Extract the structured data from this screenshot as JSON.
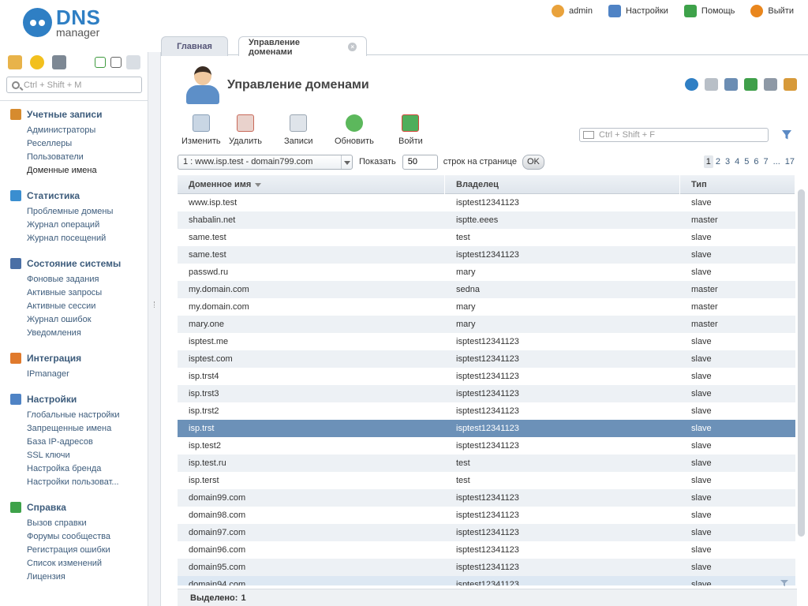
{
  "app": {
    "logo_top": "DNS",
    "logo_bottom": "manager"
  },
  "topbar": {
    "user": "admin",
    "settings": "Настройки",
    "help": "Помощь",
    "logout": "Выйти"
  },
  "sidebar": {
    "search_placeholder": "Ctrl + Shift + M",
    "sections": [
      {
        "title": "Учетные записи",
        "icon": "user-icon",
        "color": "#d68b2e",
        "items": [
          "Администраторы",
          "Реселлеры",
          "Пользователи",
          "Доменные имена"
        ]
      },
      {
        "title": "Статистика",
        "icon": "chart-icon",
        "color": "#3a8ed0",
        "items": [
          "Проблемные домены",
          "Журнал операций",
          "Журнал посещений"
        ]
      },
      {
        "title": "Состояние системы",
        "icon": "monitor-icon",
        "color": "#4a6fa5",
        "items": [
          "Фоновые задания",
          "Активные запросы",
          "Активные сессии",
          "Журнал ошибок",
          "Уведомления"
        ]
      },
      {
        "title": "Интеграция",
        "icon": "puzzle-icon",
        "color": "#e07a2c",
        "items": [
          "IPmanager"
        ]
      },
      {
        "title": "Настройки",
        "icon": "settings-icon",
        "color": "#4f83c5",
        "items": [
          "Глобальные настройки",
          "Запрещенные имена",
          "База IP-адресов",
          "SSL ключи",
          "Настройка бренда",
          "Настройки пользоват..."
        ]
      },
      {
        "title": "Справка",
        "icon": "help-icon",
        "color": "#3ea24a",
        "items": [
          "Вызов справки",
          "Форумы сообщества",
          "Регистрация ошибки",
          "Список изменений",
          "Лицензия"
        ]
      }
    ]
  },
  "tabs": {
    "home": "Главная",
    "domains": "Управление доменами"
  },
  "page": {
    "title": "Управление доменами"
  },
  "toolbar": {
    "edit": "Изменить",
    "delete": "Удалить",
    "records": "Записи",
    "refresh": "Обновить",
    "login": "Войти"
  },
  "filter": {
    "placeholder": "Ctrl + Shift + F"
  },
  "paging": {
    "list_value": "1 : www.isp.test - domain799.com",
    "show_label": "Показать",
    "rows_per_page": "50",
    "rows_label": "строк на странице",
    "ok": "OK",
    "pages": [
      "1",
      "2",
      "3",
      "4",
      "5",
      "6",
      "7",
      "...",
      "17"
    ],
    "current_page": "1"
  },
  "table": {
    "headers": [
      "Доменное имя",
      "Владелец",
      "Тип"
    ],
    "rows": [
      [
        "www.isp.test",
        "isptest12341123",
        "slave"
      ],
      [
        "shabalin.net",
        "isptte.eees",
        "master"
      ],
      [
        "same.test",
        "test",
        "slave"
      ],
      [
        "same.test",
        "isptest12341123",
        "slave"
      ],
      [
        "passwd.ru",
        "mary",
        "slave"
      ],
      [
        "my.domain.com",
        "sedna",
        "master"
      ],
      [
        "my.domain.com",
        "mary",
        "master"
      ],
      [
        "mary.one",
        "mary",
        "master"
      ],
      [
        "isptest.me",
        "isptest12341123",
        "slave"
      ],
      [
        "isptest.com",
        "isptest12341123",
        "slave"
      ],
      [
        "isp.trst4",
        "isptest12341123",
        "slave"
      ],
      [
        "isp.trst3",
        "isptest12341123",
        "slave"
      ],
      [
        "isp.trst2",
        "isptest12341123",
        "slave"
      ],
      [
        "isp.trst",
        "isptest12341123",
        "slave"
      ],
      [
        "isp.test2",
        "isptest12341123",
        "slave"
      ],
      [
        "isp.test.ru",
        "test",
        "slave"
      ],
      [
        "isp.terst",
        "test",
        "slave"
      ],
      [
        "domain99.com",
        "isptest12341123",
        "slave"
      ],
      [
        "domain98.com",
        "isptest12341123",
        "slave"
      ],
      [
        "domain97.com",
        "isptest12341123",
        "slave"
      ],
      [
        "domain96.com",
        "isptest12341123",
        "slave"
      ],
      [
        "domain95.com",
        "isptest12341123",
        "slave"
      ],
      [
        "domain94.com",
        "isptest12341123",
        "slave"
      ]
    ],
    "selected_row": 13
  },
  "status": {
    "selected_label": "Выделено:",
    "selected_count": "1"
  },
  "colors": {
    "accent": "#2f7fc4",
    "selected_row": "#6c91b8",
    "link": "#3d5c7c"
  }
}
